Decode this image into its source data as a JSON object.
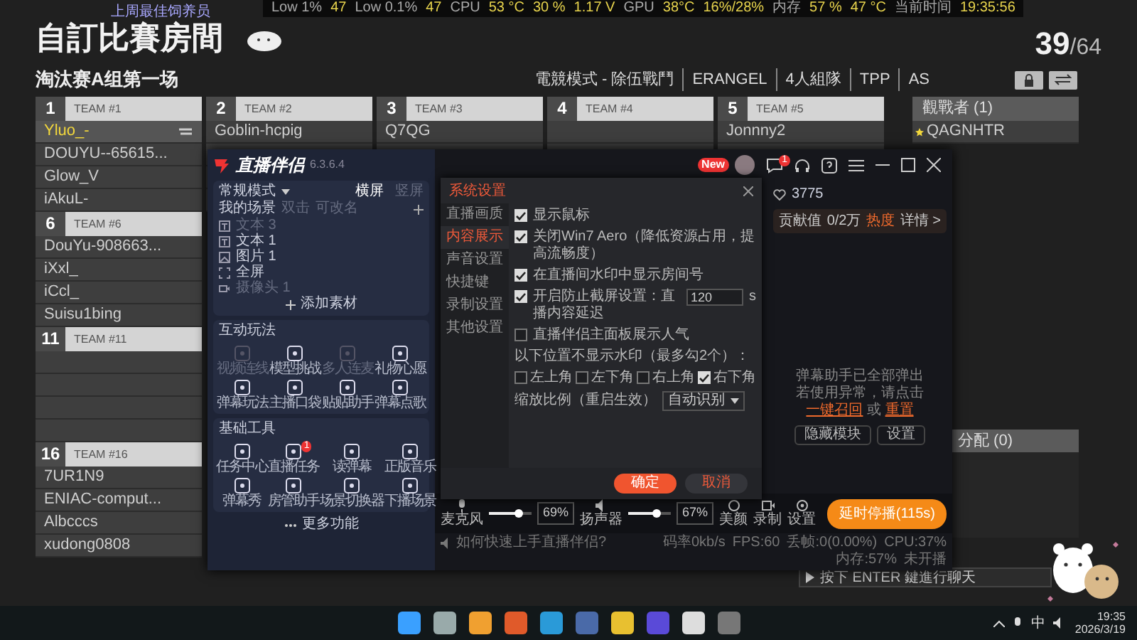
{
  "stats_bar": [
    {
      "text": "Low 1%",
      "kind": "label"
    },
    {
      "text": "47",
      "kind": "value"
    },
    {
      "text": "Low 0.1%",
      "kind": "label"
    },
    {
      "text": "47",
      "kind": "value"
    },
    {
      "text": "CPU",
      "kind": "label"
    },
    {
      "text": "53 °C",
      "kind": "value"
    },
    {
      "text": "30 %",
      "kind": "value"
    },
    {
      "text": "1.17 V",
      "kind": "value"
    },
    {
      "text": "GPU",
      "kind": "label"
    },
    {
      "text": "38°C",
      "kind": "value"
    },
    {
      "text": "16%/28%",
      "kind": "value"
    },
    {
      "text": "内存",
      "kind": "label"
    },
    {
      "text": "57 %",
      "kind": "value"
    },
    {
      "text": "47 °C",
      "kind": "value"
    },
    {
      "text": "当前时间",
      "kind": "label"
    },
    {
      "text": "19:35:56",
      "kind": "value"
    }
  ],
  "overlay_caption": "上周最佳饲养员",
  "lobby": {
    "title": "自訂比賽房間",
    "count": "39",
    "capacity": "/64",
    "match_name": "淘汰赛A组第一场",
    "mode_tags": [
      "電競模式 - 除伍戰鬥",
      "ERANGEL",
      "4人組隊",
      "TPP",
      "AS"
    ],
    "columns": [
      [
        {
          "number": "1",
          "name": "TEAM #1",
          "players": [
            {
              "name": "Yluo_-",
              "selected": true
            },
            {
              "name": "DOUYU--65615...",
              "selected": false
            },
            {
              "name": "Glow_V",
              "selected": false
            },
            {
              "name": "iAkuL-",
              "selected": false
            }
          ]
        },
        {
          "number": "6",
          "name": "TEAM #6",
          "players": [
            {
              "name": "DouYu-908663...",
              "selected": false
            },
            {
              "name": "iXxl_",
              "selected": false
            },
            {
              "name": "iCcl_",
              "selected": false
            },
            {
              "name": "Suisu1bing",
              "selected": false
            }
          ]
        },
        {
          "number": "11",
          "name": "TEAM #11"
        },
        {
          "number": "16",
          "name": "TEAM #16",
          "players": [
            {
              "name": "7UR1N9",
              "selected": false
            },
            {
              "name": "ENIAC-comput...",
              "selected": false
            },
            {
              "name": "Albcccs",
              "selected": false
            },
            {
              "name": "xudong0808",
              "selected": false
            }
          ]
        }
      ],
      [
        {
          "number": "2",
          "name": "TEAM #2",
          "players": [
            {
              "name": "Goblin-hcpig",
              "selected": false
            }
          ]
        }
      ],
      [
        {
          "number": "3",
          "name": "TEAM #3",
          "players": [
            {
              "name": "Q7QG",
              "selected": false
            }
          ]
        }
      ],
      [
        {
          "number": "4",
          "name": "TEAM #4"
        }
      ],
      [
        {
          "number": "5",
          "name": "TEAM #5",
          "players": [
            {
              "name": "Jonnny2",
              "selected": false
            }
          ]
        }
      ]
    ],
    "spectators": {
      "title": "觀戰者 (1)",
      "players": [
        "QAGNHTR"
      ]
    },
    "unassigned": {
      "title": "分配 (0)"
    },
    "chat_hint": "按下 ENTER 鍵進行聊天"
  },
  "app": {
    "title": "直播伴侣",
    "version": "6.3.6.4",
    "new_badge": "New",
    "chat_badge": "1",
    "modes": {
      "label": "常规模式",
      "orientations": [
        {
          "label": "横屏",
          "selected": true
        },
        {
          "label": "竖屏",
          "selected": false
        }
      ]
    },
    "scenes": {
      "title": "我的场景",
      "hints": [
        "双击",
        "可改名"
      ],
      "items": [
        {
          "label": "文本 3",
          "kind": "text",
          "disabled": true
        },
        {
          "label": "文本 1",
          "kind": "text",
          "disabled": false
        },
        {
          "label": "图片 1",
          "kind": "image",
          "disabled": false
        },
        {
          "label": "全屏",
          "kind": "screen",
          "disabled": false
        },
        {
          "label": "摄像头 1",
          "kind": "camera",
          "disabled": true
        }
      ],
      "add": "添加素材"
    },
    "sections": [
      {
        "title": "互动玩法",
        "tools": [
          {
            "label": "视频连线",
            "disabled": true
          },
          {
            "label": "模型挑战",
            "disabled": false
          },
          {
            "label": "多人连麦",
            "disabled": true
          },
          {
            "label": "礼物心愿",
            "disabled": false
          },
          {
            "label": "弹幕玩法",
            "disabled": false
          },
          {
            "label": "主播口袋",
            "disabled": false
          },
          {
            "label": "贴贴助手",
            "disabled": false
          },
          {
            "label": "弹幕点歌",
            "disabled": false
          }
        ]
      },
      {
        "title": "基础工具",
        "tools": [
          {
            "label": "任务中心",
            "disabled": false
          },
          {
            "label": "直播任务",
            "disabled": false,
            "badge": "1"
          },
          {
            "label": "读弹幕",
            "disabled": false
          },
          {
            "label": "正版音乐",
            "disabled": false
          },
          {
            "label": "弹幕秀",
            "disabled": false
          },
          {
            "label": "房管助手",
            "disabled": false
          },
          {
            "label": "场景切换器",
            "disabled": false
          },
          {
            "label": "下播场景",
            "disabled": false
          }
        ]
      }
    ],
    "more": "更多功能",
    "likes": "3775",
    "contribution": {
      "label": "贡献值",
      "value": "0/2万",
      "heat": "热度",
      "details": "详情 >"
    },
    "notice": {
      "title": "弹幕助手已全部弹出",
      "parts": [
        {
          "text": "若使用异常，请点击",
          "kind": "text"
        },
        {
          "text": "一键召回",
          "kind": "link"
        },
        {
          "text": "或",
          "kind": "text"
        },
        {
          "text": "重置",
          "kind": "link"
        }
      ],
      "buttons": [
        "隐藏模块",
        "设置"
      ]
    },
    "controls": {
      "mic": {
        "label": "麦克风",
        "level": 0.69,
        "reading": "69%"
      },
      "speaker": {
        "label": "扬声器",
        "level": 0.67,
        "reading": "67%"
      },
      "tools": [
        "美颜",
        "录制",
        "设置"
      ],
      "go_button": "延时停播(115s)"
    },
    "status": {
      "help": "如何快速上手直播伴侣?",
      "items": [
        "码率0kb/s",
        "FPS:60",
        "丢帧:0(0.00%)",
        "CPU:37%",
        "内存:57%",
        "未开播"
      ]
    }
  },
  "dialog": {
    "title": "系统设置",
    "nav": [
      {
        "label": "直播画质",
        "selected": false
      },
      {
        "label": "内容展示",
        "selected": true
      },
      {
        "label": "声音设置",
        "selected": false
      },
      {
        "label": "快捷键",
        "selected": false
      },
      {
        "label": "录制设置",
        "selected": false
      },
      {
        "label": "其他设置",
        "selected": false
      }
    ],
    "options": [
      {
        "label": "显示鼠标",
        "checked": true
      },
      {
        "label": "关闭Win7 Aero（降低资源占用，提高流畅度）",
        "checked": true
      },
      {
        "label": "在直播间水印中显示房间号",
        "checked": true
      },
      {
        "label": "开启防止截屏设置：直播内容延迟",
        "checked": true,
        "value": "120",
        "unit": "s"
      },
      {
        "label": "直播伴侣主面板展示人气",
        "checked": false
      }
    ],
    "watermark_label": "以下位置不显示水印（最多勾2个）：",
    "positions": [
      {
        "label": "左上角",
        "checked": false
      },
      {
        "label": "左下角",
        "checked": false
      },
      {
        "label": "右上角",
        "checked": false
      },
      {
        "label": "右下角",
        "checked": true
      }
    ],
    "scale": {
      "label": "缩放比例（重启生效）",
      "value": "自动识别"
    },
    "buttons": [
      {
        "label": "确定",
        "kind": "primary"
      },
      {
        "label": "取消",
        "kind": "secondary"
      }
    ]
  },
  "taskbar": {
    "ime": "中",
    "time": "19:35",
    "date": "2026/3/19"
  }
}
